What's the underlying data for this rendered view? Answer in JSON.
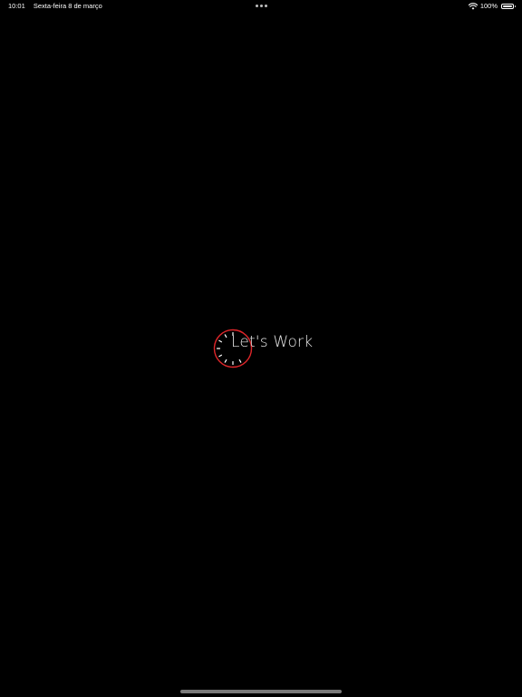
{
  "status_bar": {
    "time": "10:01",
    "date": "Sexta-feira 8 de março",
    "battery": "100%",
    "icons": [
      "more-dots-icon",
      "wifi-icon",
      "battery-icon"
    ]
  },
  "splash": {
    "title": "Let's Work",
    "logo_icon": "clock-icon",
    "accent_color": "#e0262a"
  },
  "colors": {
    "background": "#000000",
    "text": "#ffffff"
  }
}
